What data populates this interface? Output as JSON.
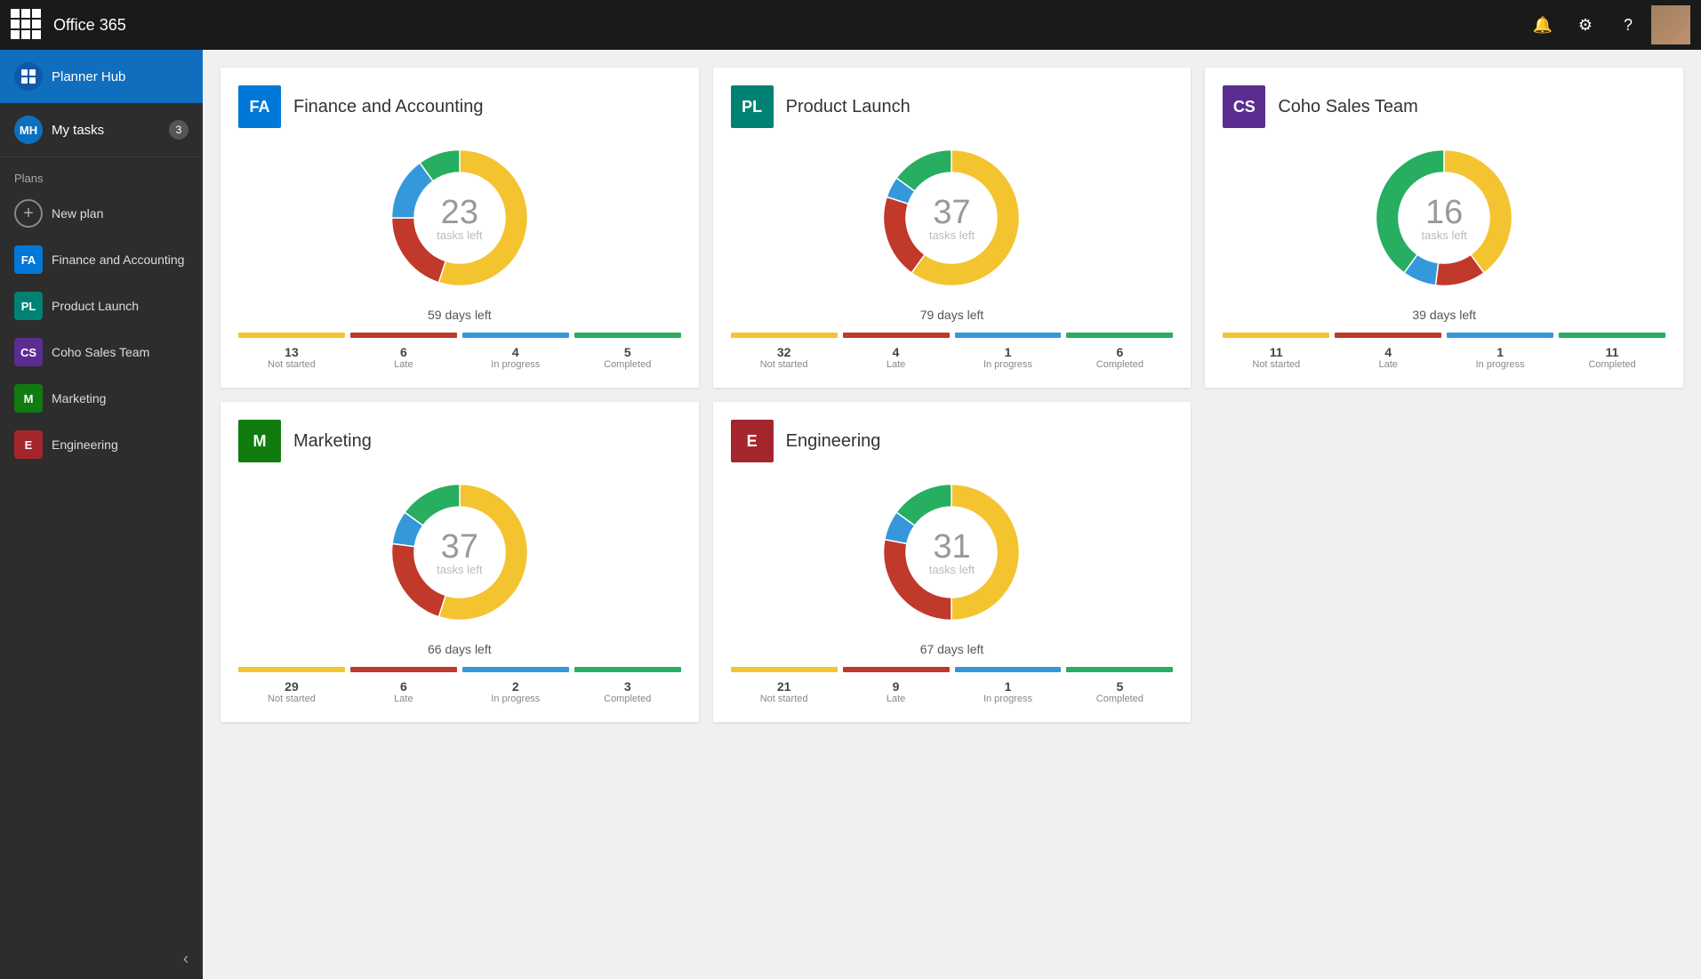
{
  "topbar": {
    "title": "Office 365",
    "waffle_label": "App launcher",
    "bell_icon": "🔔",
    "gear_icon": "⚙",
    "help_icon": "?"
  },
  "sidebar": {
    "planner_hub": "Planner Hub",
    "planner_circle": "●",
    "my_tasks_label": "My tasks",
    "my_tasks_initials": "MH",
    "my_tasks_count": "3",
    "plans_label": "Plans",
    "new_plan_label": "New plan",
    "items": [
      {
        "id": "finance",
        "label": "Finance and Accounting",
        "abbr": "FA",
        "color": "abbr-blue"
      },
      {
        "id": "product-launch",
        "label": "Product Launch",
        "abbr": "PL",
        "color": "abbr-teal"
      },
      {
        "id": "coho-sales",
        "label": "Coho Sales Team",
        "abbr": "CS",
        "color": "abbr-purple"
      },
      {
        "id": "marketing",
        "label": "Marketing",
        "abbr": "M",
        "color": "abbr-green"
      },
      {
        "id": "engineering",
        "label": "Engineering",
        "abbr": "E",
        "color": "abbr-darkred"
      }
    ]
  },
  "cards": [
    {
      "id": "finance",
      "title": "Finance and Accounting",
      "abbr": "FA",
      "abbr_color": "abbr-blue",
      "tasks_left": "23",
      "tasks_label": "tasks left",
      "days_left": "59 days left",
      "not_started": 13,
      "late": 6,
      "in_progress": 4,
      "completed": 5,
      "donut": {
        "yellow": 55,
        "red": 20,
        "blue": 15,
        "green": 10
      }
    },
    {
      "id": "product-launch",
      "title": "Product Launch",
      "abbr": "PL",
      "abbr_color": "abbr-teal",
      "tasks_left": "37",
      "tasks_label": "tasks left",
      "days_left": "79 days left",
      "not_started": 32,
      "late": 4,
      "in_progress": 1,
      "completed": 6,
      "donut": {
        "yellow": 60,
        "red": 20,
        "blue": 5,
        "green": 15
      }
    },
    {
      "id": "coho-sales",
      "title": "Coho Sales Team",
      "abbr": "CS",
      "abbr_color": "abbr-purple",
      "tasks_left": "16",
      "tasks_label": "tasks left",
      "days_left": "39 days left",
      "not_started": 11,
      "late": 4,
      "in_progress": 1,
      "completed": 11,
      "donut": {
        "yellow": 40,
        "red": 12,
        "blue": 8,
        "green": 40
      }
    },
    {
      "id": "marketing",
      "title": "Marketing",
      "abbr": "M",
      "abbr_color": "abbr-green",
      "tasks_left": "37",
      "tasks_label": "tasks left",
      "days_left": "66 days left",
      "not_started": 29,
      "late": 6,
      "in_progress": 2,
      "completed": 3,
      "donut": {
        "yellow": 55,
        "red": 22,
        "blue": 8,
        "green": 15
      }
    },
    {
      "id": "engineering",
      "title": "Engineering",
      "abbr": "E",
      "abbr_color": "abbr-darkred",
      "tasks_left": "31",
      "tasks_label": "tasks left",
      "days_left": "67 days left",
      "not_started": 21,
      "late": 9,
      "in_progress": 1,
      "completed": 5,
      "donut": {
        "yellow": 50,
        "red": 28,
        "blue": 7,
        "green": 15
      }
    }
  ],
  "labels": {
    "not_started": "Not started",
    "late": "Late",
    "in_progress": "In progress",
    "completed": "Completed"
  }
}
